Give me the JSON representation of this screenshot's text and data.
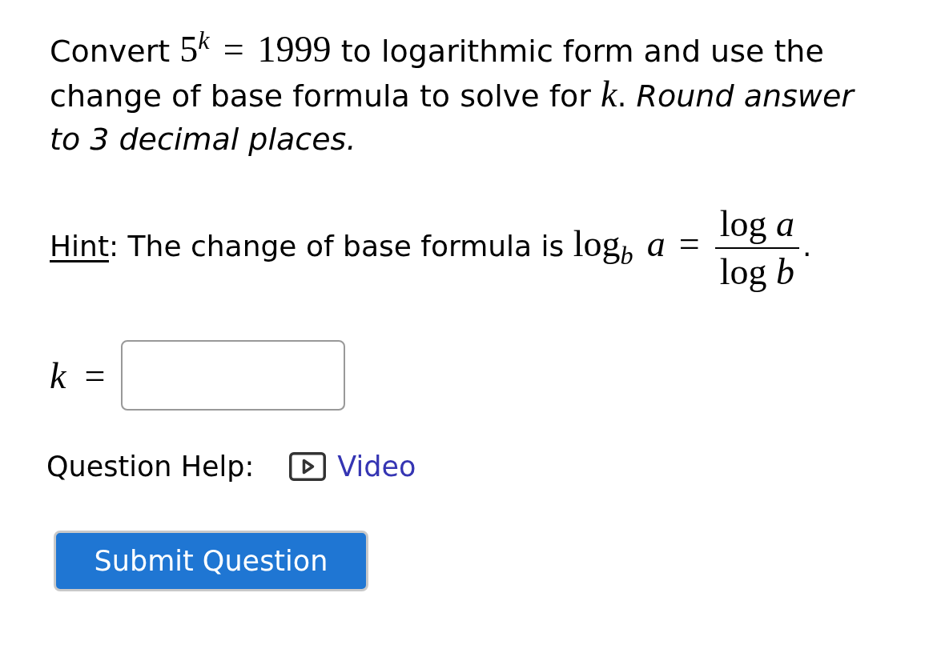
{
  "question": {
    "parts": [
      {
        "kind": "text",
        "text": "Convert "
      },
      {
        "kind": "math",
        "text": "5$^{k}$ = 1999"
      },
      {
        "kind": "text",
        "text": " to logarithmic form and use the change of base formula to solve for "
      },
      {
        "kind": "math",
        "text": "*k*"
      },
      {
        "kind": "text",
        "text": ". "
      },
      {
        "kind": "emphasis",
        "text": "Round answer to 3 decimal places."
      }
    ]
  },
  "hint": {
    "parts": [
      {
        "kind": "underline",
        "text": "Hint"
      },
      {
        "kind": "text",
        "text": ": The change of base formula is "
      },
      {
        "kind": "math",
        "text": "log$_{b}$ *a* = "
      },
      {
        "kind": "fraction",
        "numerator": "log *a*",
        "denominator": "log *b*"
      },
      {
        "kind": "text",
        "text": "."
      }
    ]
  },
  "answer": {
    "label": "*k* ="
  },
  "question_help": {
    "label": "Question Help:",
    "links": [
      {
        "kind": "video",
        "label": "Video"
      }
    ]
  },
  "submit_button": {
    "label": "Submit Question"
  }
}
